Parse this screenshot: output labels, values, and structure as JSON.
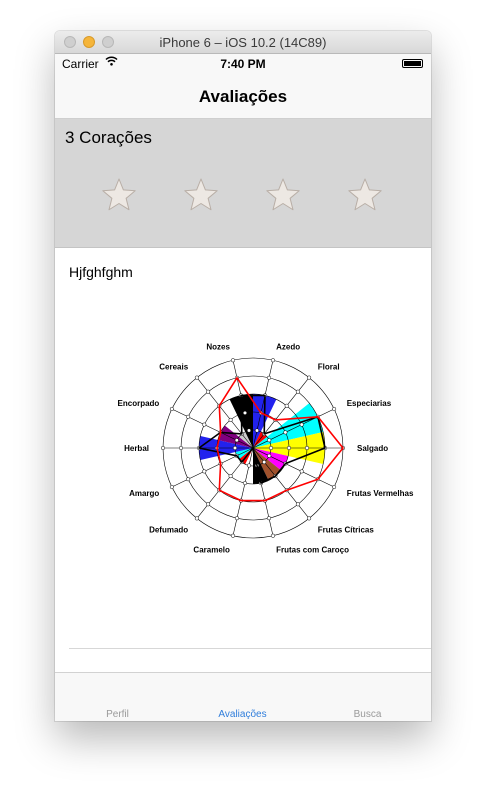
{
  "window": {
    "title": "iPhone 6 – iOS 10.2 (14C89)"
  },
  "status_bar": {
    "carrier": "Carrier",
    "time": "7:40 PM",
    "wifi_icon": "wifi-icon",
    "battery_icon": "battery-icon"
  },
  "nav": {
    "title": "Avaliações"
  },
  "rating": {
    "title": "3 Corações",
    "stars": [
      "star-icon",
      "star-icon",
      "star-icon",
      "star-icon"
    ],
    "star_color": "#ede8e3"
  },
  "card": {
    "name": "Hjfghfghm"
  },
  "chart_data": {
    "type": "radar",
    "axes": [
      "Azedo",
      "Floral",
      "Especiarias",
      "Salgado",
      "Frutas Vermelhas",
      "Frutas Cítricas",
      "Frutas com Caroço",
      "Caramelo",
      "Defumado",
      "Amargo",
      "Herbal",
      "Encorpado",
      "Cereais",
      "Nozes"
    ],
    "scale_max": 5,
    "rings": 5,
    "axis_colors": [
      "#2222ee",
      "#ff0000",
      "#00ffff",
      "#ffff00",
      "#ff00ff",
      "#a0522d",
      "#000000",
      "#ffffff",
      "#ff0000",
      "#00ffff",
      "#2222ee",
      "#800080",
      "#cccccc",
      "#000000"
    ],
    "sector_values": [
      3,
      1,
      4,
      4,
      2,
      2,
      2,
      0,
      1,
      1,
      3,
      2,
      1,
      3
    ],
    "series": [
      {
        "color": "#000000",
        "values": [
          3,
          1,
          4,
          4,
          2,
          2,
          2,
          0,
          1,
          1,
          3,
          2,
          1,
          3
        ]
      },
      {
        "color": "#ff0000",
        "values": [
          2,
          2,
          4,
          5,
          4,
          3,
          3,
          3,
          3,
          2,
          2,
          2,
          3,
          4
        ]
      }
    ]
  },
  "tab_bar": {
    "tabs": [
      {
        "label": "Perfil",
        "active": false
      },
      {
        "label": "Avaliações",
        "active": true
      },
      {
        "label": "Busca",
        "active": false
      }
    ],
    "active_color": "#2f7ddb"
  }
}
